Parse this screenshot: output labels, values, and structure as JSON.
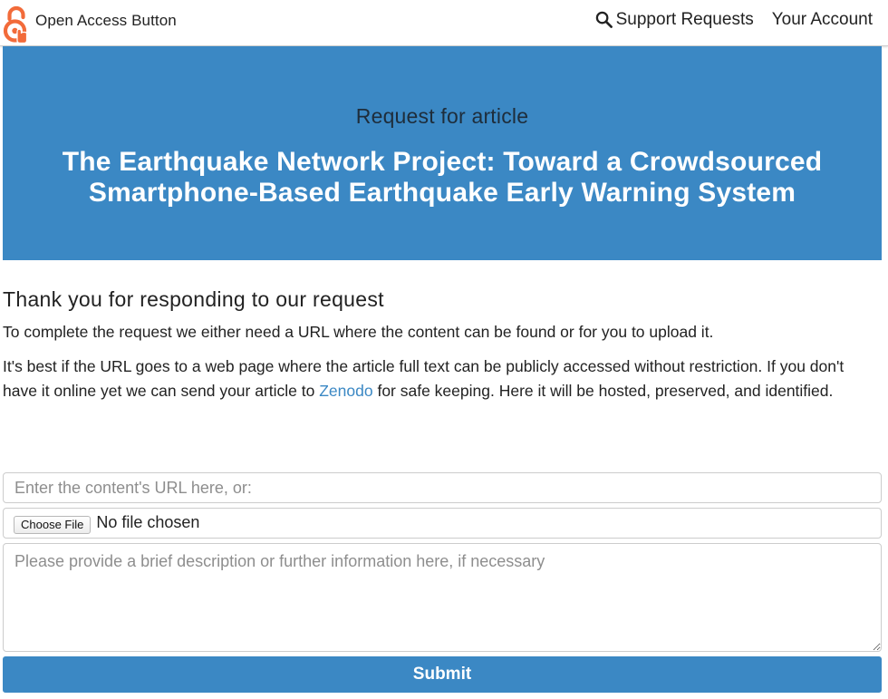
{
  "navbar": {
    "brand_text": "Open Access Button",
    "logo_icon": "open-access-lock-icon",
    "links": [
      {
        "label": "Support Requests",
        "icon": "search-icon"
      },
      {
        "label": "Your Account"
      }
    ]
  },
  "hero": {
    "subtitle": "Request for article",
    "title": "The Earthquake Network Project: Toward a Crowdsourced Smartphone-Based Earthquake Early Warning System"
  },
  "main": {
    "heading": "Thank you for responding to our request",
    "p1": "To complete the request we either need a URL where the content can be found or for you to upload it.",
    "p2_before": "It's best if the URL goes to a web page where the article full text can be publicly accessed without restriction. If you don't have it online yet we can send your article to ",
    "p2_link": "Zenodo",
    "p2_after": " for safe keeping. Here it will be hosted, preserved, and identified."
  },
  "form": {
    "url_placeholder": "Enter the content's URL here, or:",
    "url_value": "",
    "file_button_label": "Choose File",
    "file_status": "No file chosen",
    "description_placeholder": "Please provide a brief description or further information here, if necessary",
    "description_value": "",
    "submit_label": "Submit"
  },
  "colors": {
    "accent": "#3b88c4",
    "hero_subtitle": "#1e2d3b",
    "logo_orange": "#f26b3a"
  }
}
